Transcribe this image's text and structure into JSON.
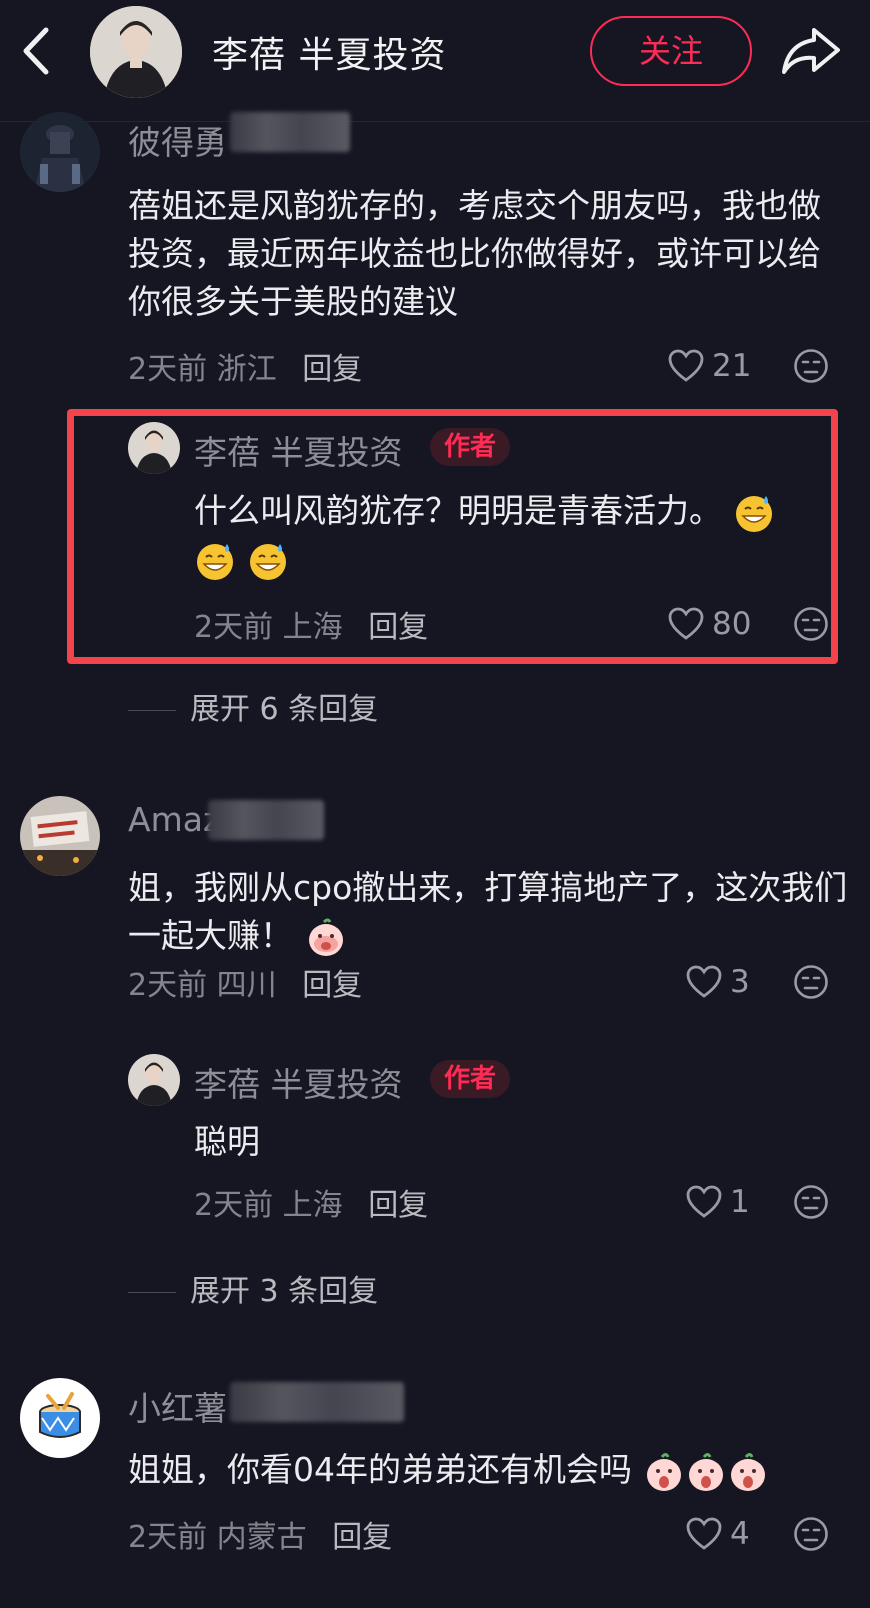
{
  "header": {
    "title": "李蓓 半夏投资",
    "follow_label": "关注",
    "back_icon": "chevron-left-icon",
    "share_icon": "share-arrow-icon"
  },
  "colors": {
    "accent": "#fe2c55",
    "highlight_box": "#f3434b",
    "background": "#161622"
  },
  "comments": [
    {
      "username": "彼得勇",
      "text": "蓓姐还是风韵犹存的，考虑交个朋友吗，我也做投资，最近两年收益也比你做得好，或许可以给你很多关于美股的建议",
      "time": "2天前",
      "location": "浙江",
      "reply_label": "回复",
      "likes": "21",
      "reply": {
        "username": "李蓓 半夏投资",
        "badge": "作者",
        "text": "什么叫风韵犹存？明明是青春活力。",
        "time": "2天前",
        "location": "上海",
        "reply_label": "回复",
        "likes": "80"
      },
      "expand_label": "展开 6 条回复"
    },
    {
      "username": "Amaz",
      "text": "姐，我刚从cpo撤出来，打算搞地产了，这次我们一起大赚！",
      "time": "2天前",
      "location": "四川",
      "reply_label": "回复",
      "likes": "3",
      "reply": {
        "username": "李蓓 半夏投资",
        "badge": "作者",
        "text": "聪明",
        "time": "2天前",
        "location": "上海",
        "reply_label": "回复",
        "likes": "1"
      },
      "expand_label": "展开 3 条回复"
    },
    {
      "username": "小红薯",
      "text": "姐姐，你看04年的弟弟还有机会吗",
      "time": "2天前",
      "location": "内蒙古",
      "reply_label": "回复",
      "likes": "4"
    }
  ]
}
